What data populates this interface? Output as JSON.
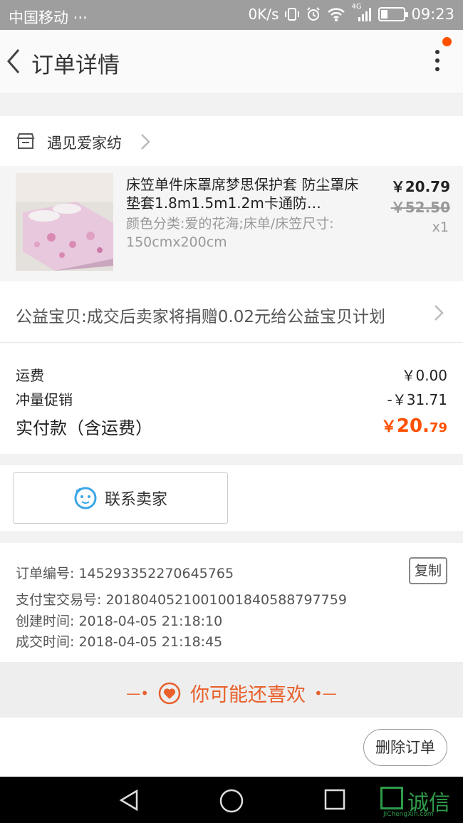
{
  "status_bar": {
    "carrier": "中国移动 ···",
    "speed": "0K/s",
    "network": "4G",
    "time": "09:23"
  },
  "header": {
    "title": "订单详情",
    "back_icon": "chevron-left-icon",
    "more_icon": "more-vertical-icon"
  },
  "shop": {
    "name": "遇见爱家纺",
    "icon": "store-icon"
  },
  "item": {
    "title": "床笠单件床罩席梦思保护套 防尘罩床垫套1.8m1.5m1.2m卡通防…",
    "sku": "颜色分类:爱的花海;床单/床笠尺寸: 150cmx200cm",
    "price": "￥20.79",
    "original_price": "￥52.50",
    "quantity": "x1"
  },
  "charity": {
    "text": "公益宝贝:成交后卖家将捐赠0.02元给公益宝贝计划"
  },
  "totals": {
    "shipping_label": "运费",
    "shipping_value": "￥0.00",
    "promo_label": "冲量促销",
    "promo_value": "-￥31.71",
    "paid_label": "实付款（含运费）",
    "paid_currency": "￥",
    "paid_int": "20.",
    "paid_dec": "79"
  },
  "contact": {
    "label": "联系卖家"
  },
  "order_info": {
    "order_no": "订单编号: 145293352270645765",
    "alipay_no": "支付宝交易号: 2018040521001001840588797759",
    "created": "创建时间: 2018-04-05 21:18:10",
    "completed": "成交时间: 2018-04-05 21:18:45",
    "copy_label": "复制"
  },
  "guess": {
    "text": "你可能还喜欢",
    "left_deco": "—•",
    "right_deco": "•—"
  },
  "actions": {
    "delete_label": "删除订单"
  },
  "watermark": {
    "cn": "诚信",
    "en": "JiChengXin.com"
  },
  "colors": {
    "accent": "#ff5000",
    "guess": "#e8602c",
    "contact_icon": "#3aa7e8"
  }
}
